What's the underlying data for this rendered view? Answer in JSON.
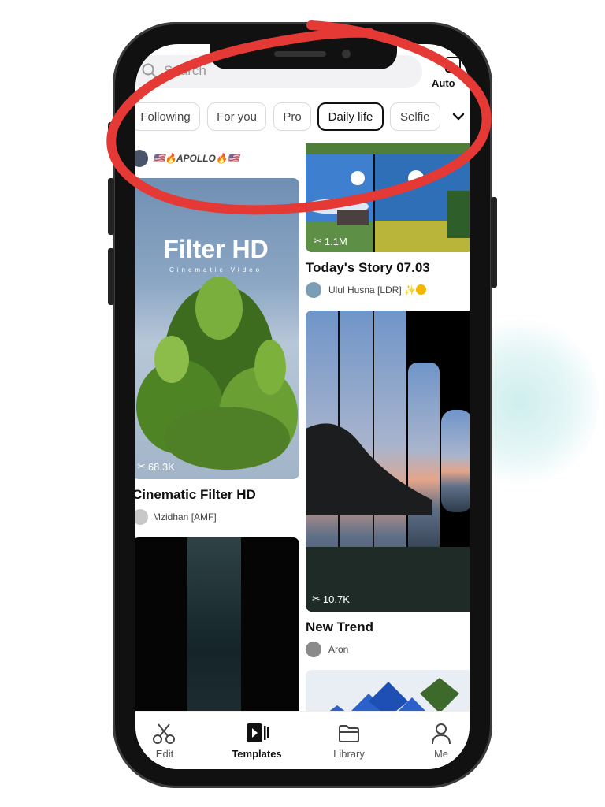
{
  "search": {
    "placeholder": "Search"
  },
  "header": {
    "auto_label": "Auto"
  },
  "tabs": [
    {
      "label": "Following"
    },
    {
      "label": "For you"
    },
    {
      "label": "Pro"
    },
    {
      "label": "Daily life"
    },
    {
      "label": "Selfie"
    }
  ],
  "feed": {
    "left": [
      {
        "author_top": "🇺🇸🔥APOLLO🔥🇺🇸"
      },
      {
        "overlay_title": "Filter HD",
        "overlay_sub": "Cinematic Video",
        "uses": "68.3K",
        "title": "Cinematic Filter HD",
        "author": "Mzidhan [AMF]"
      }
    ],
    "right": [
      {
        "uses": "1.1M",
        "title": "Today's Story 07.03",
        "author": "Ulul Husna [LDR] ✨"
      },
      {
        "uses": "10.7K",
        "title": "New Trend",
        "author": "Aron"
      }
    ]
  },
  "nav": [
    {
      "label": "Edit"
    },
    {
      "label": "Templates"
    },
    {
      "label": "Library"
    },
    {
      "label": "Me"
    }
  ],
  "colors": {
    "annotation": "#e53935",
    "active_tab_border": "#111111"
  }
}
